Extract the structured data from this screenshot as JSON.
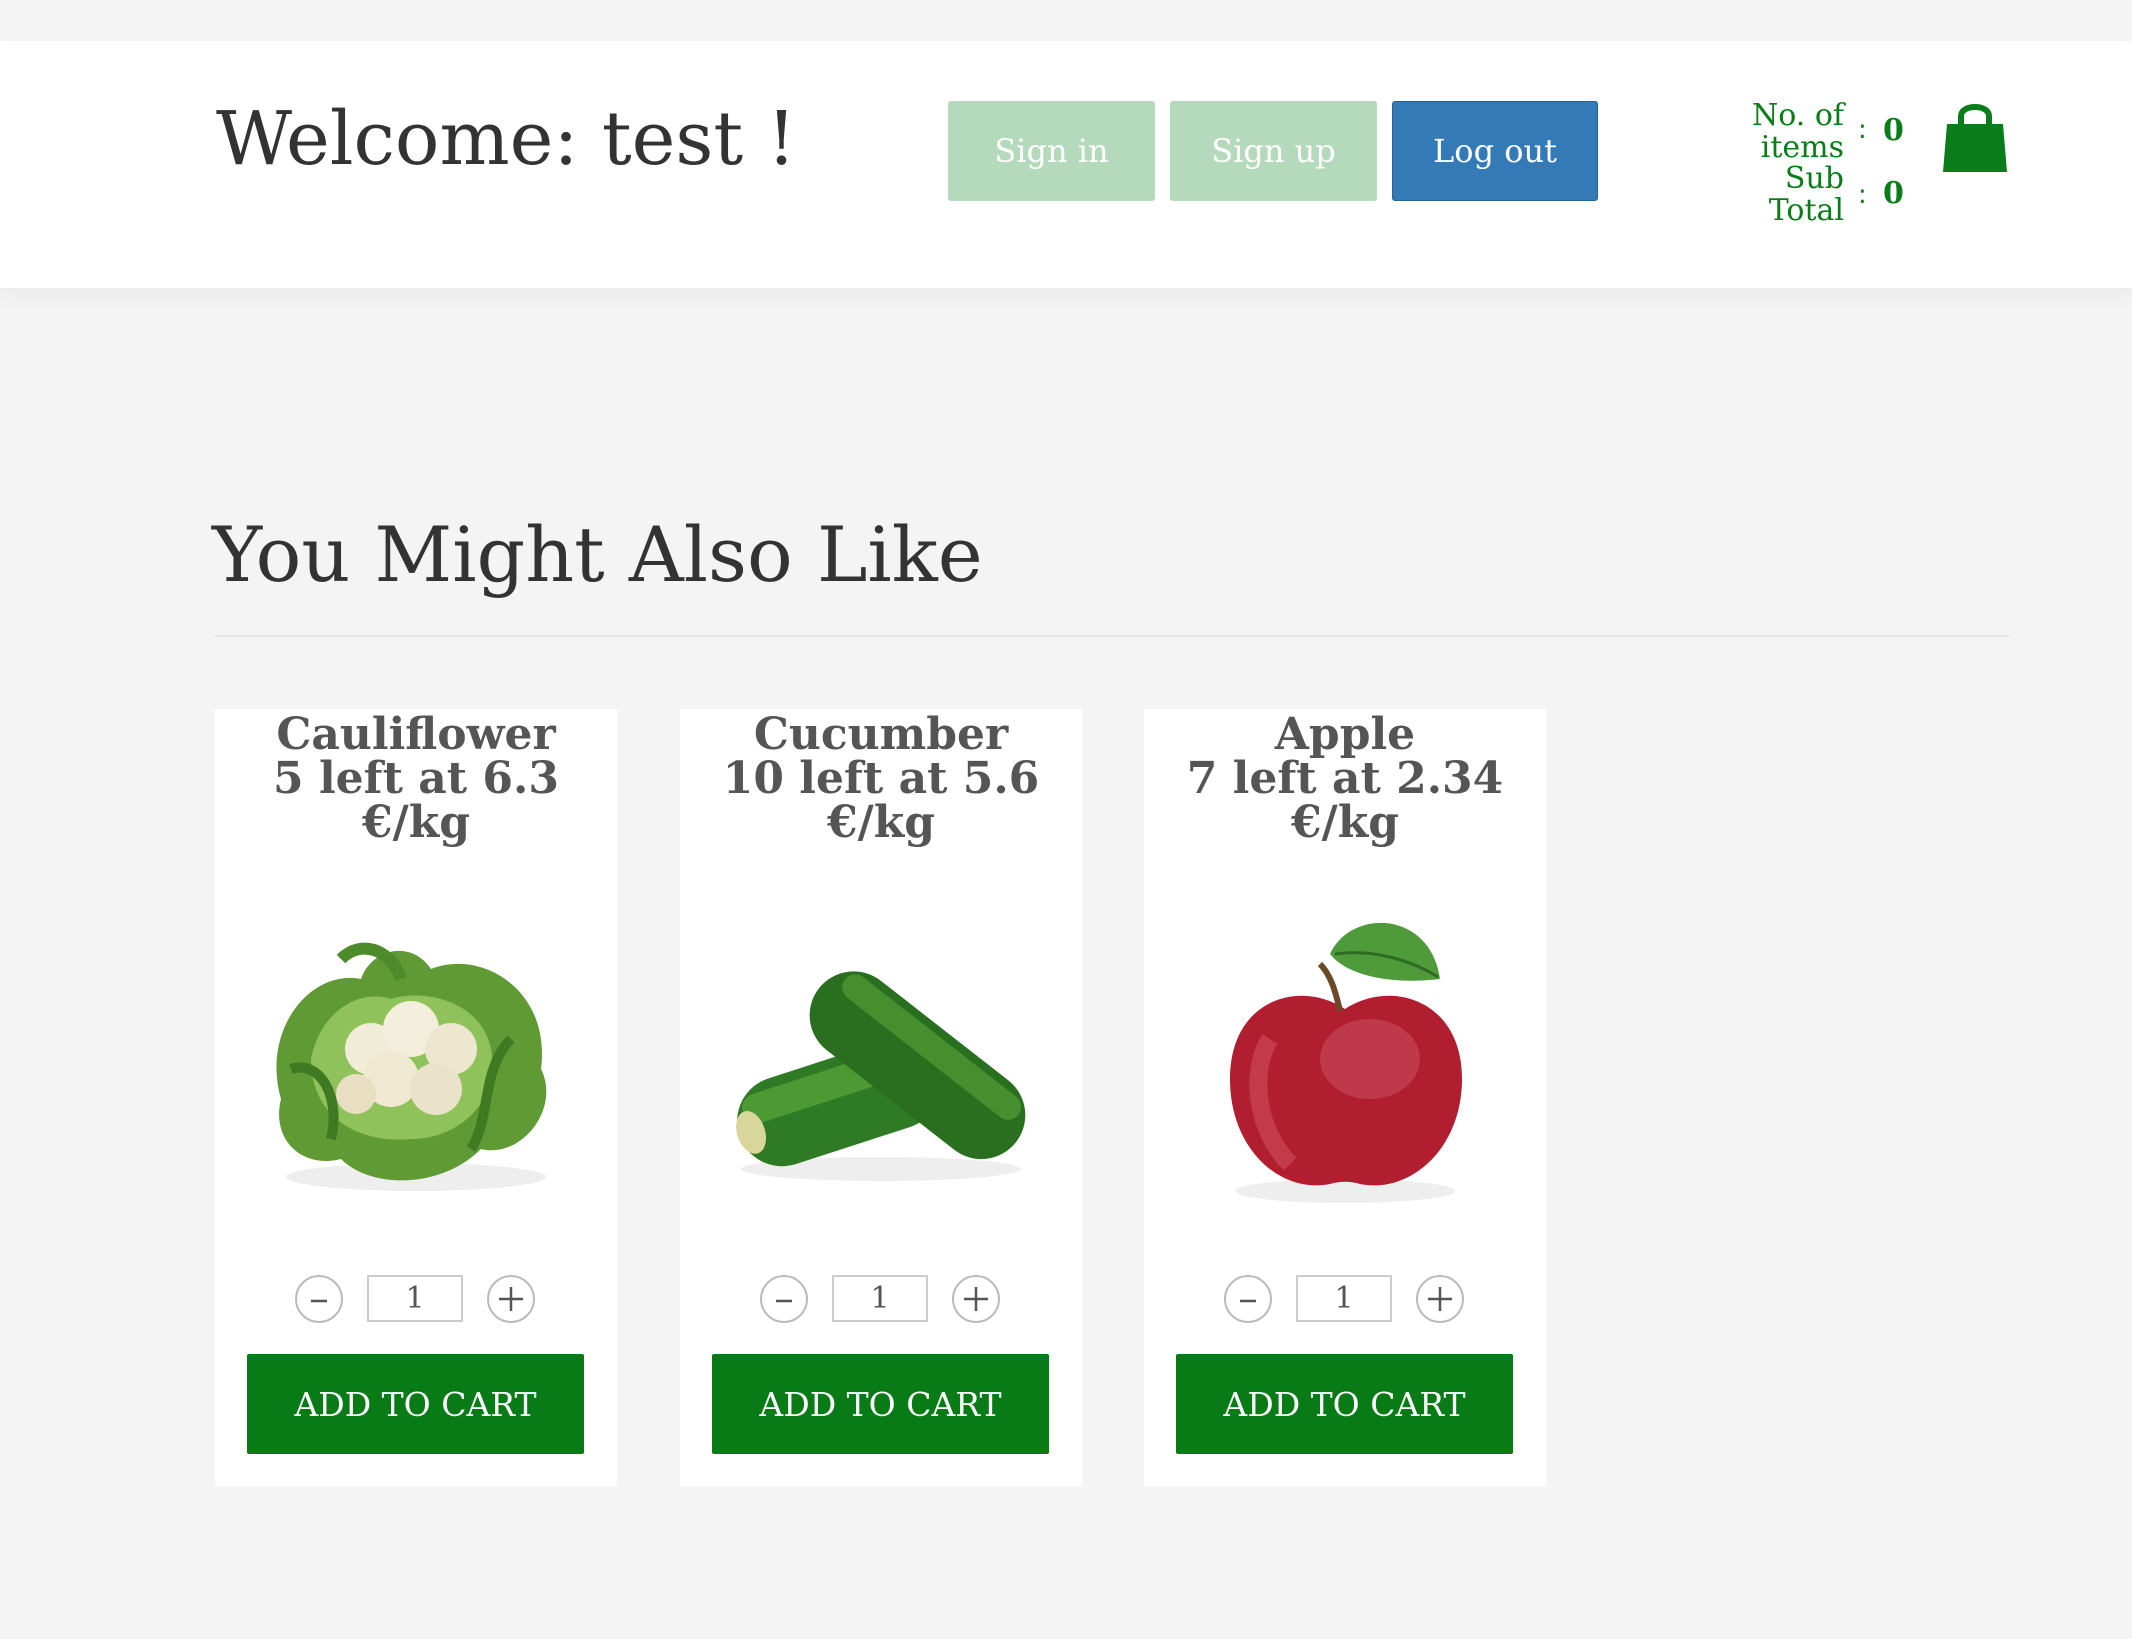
{
  "header": {
    "welcome": "Welcome: test !",
    "sign_in": "Sign in",
    "sign_up": "Sign up",
    "log_out": "Log out",
    "cart": {
      "items_label_line1": "No. of",
      "items_label_line2": "items",
      "items_value": "0",
      "total_label_line1": "Sub",
      "total_label_line2": "Total",
      "total_value": "0",
      "colon": ":",
      "icon": "shopping-bag-icon"
    }
  },
  "section": {
    "title": "You Might Also Like"
  },
  "products": [
    {
      "name": "Cauliflower",
      "stock_line": "5 left at 6.3",
      "unit": "€/kg",
      "quantity": "1",
      "add_label": "ADD TO CART",
      "image": "cauliflower-image"
    },
    {
      "name": "Cucumber",
      "stock_line": "10 left at 5.6",
      "unit": "€/kg",
      "quantity": "1",
      "add_label": "ADD TO CART",
      "image": "cucumber-image"
    },
    {
      "name": "Apple",
      "stock_line": "7 left at 2.34",
      "unit": "€/kg",
      "quantity": "1",
      "add_label": "ADD TO CART",
      "image": "apple-image"
    }
  ],
  "colors": {
    "accent_green": "#087b17",
    "text_green": "#0a7d1a",
    "disabled_button": "#b5dabb",
    "primary_blue": "#337ab7",
    "page_background": "#f4f4f4"
  }
}
